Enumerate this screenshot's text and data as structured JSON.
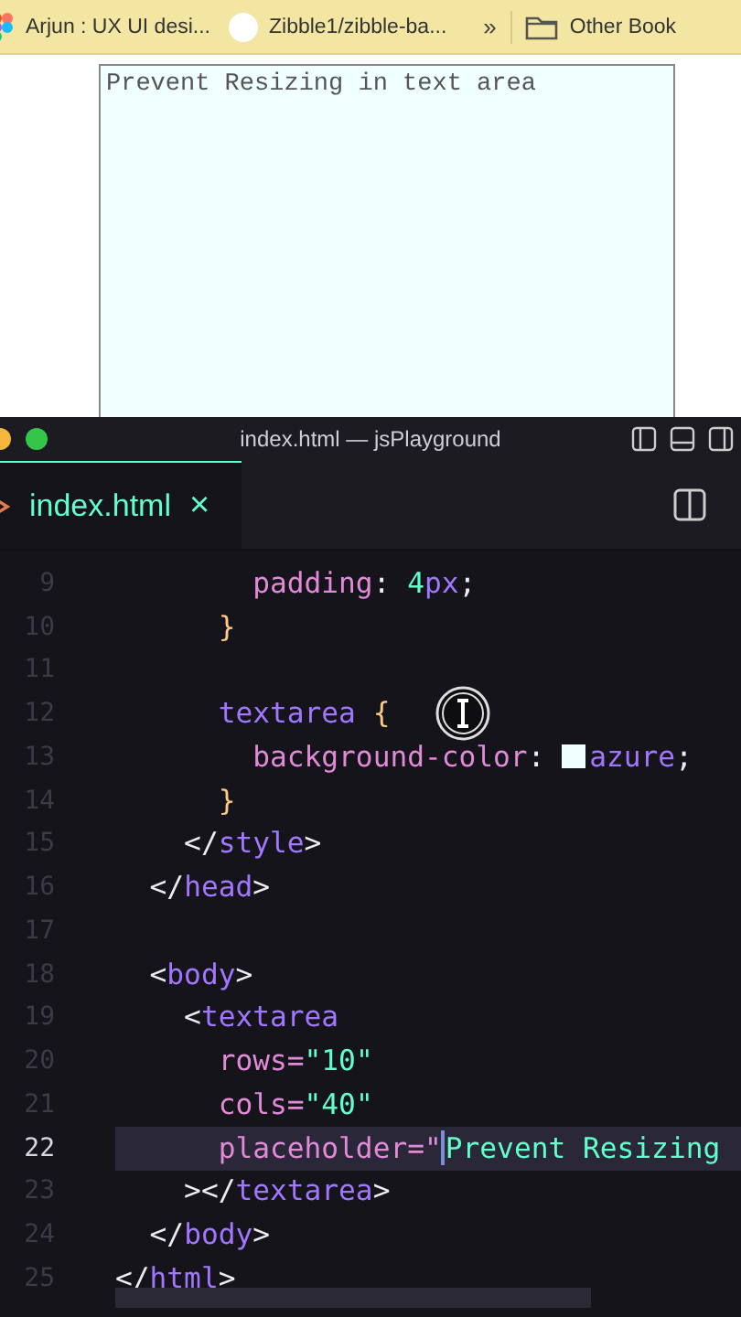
{
  "bookmarks_bar": {
    "items": [
      {
        "kind": "favicon",
        "label": "Arjun : UX UI desi..."
      },
      {
        "kind": "github",
        "label": "Zibble1/zibble-ba..."
      }
    ],
    "overflow": "»",
    "folder": {
      "label": "Other Book"
    }
  },
  "preview": {
    "textarea": {
      "placeholder": "Prevent Resizing in text area"
    }
  },
  "editor": {
    "window": {
      "title": "index.html — jsPlayground"
    },
    "tabs": [
      {
        "label": "index.html",
        "selected": true,
        "close": "×"
      }
    ],
    "lines": [
      {
        "number": "9",
        "selected": false,
        "tokens": [
          {
            "kind": "property",
            "text": "        padding"
          },
          {
            "kind": "punct",
            "text": ": "
          },
          {
            "kind": "number",
            "text": "4"
          },
          {
            "kind": "unit",
            "text": "px"
          },
          {
            "kind": "punct",
            "text": ";"
          }
        ]
      },
      {
        "number": "10",
        "selected": false,
        "tokens": [
          {
            "kind": "brace",
            "text": "      }"
          }
        ]
      },
      {
        "number": "11",
        "selected": false
      },
      {
        "number": "12",
        "selected": false,
        "tokens": [
          {
            "kind": "selector",
            "text": "      textarea"
          },
          {
            "kind": "brace",
            "text": " {"
          }
        ]
      },
      {
        "number": "13",
        "selected": false,
        "tokens": [
          {
            "kind": "property",
            "text": "        background-color"
          },
          {
            "kind": "punct",
            "text": ": "
          },
          {
            "kind": "swatch"
          },
          {
            "kind": "value",
            "text": "azure"
          },
          {
            "kind": "punct",
            "text": ";"
          }
        ]
      },
      {
        "number": "14",
        "selected": false,
        "tokens": [
          {
            "kind": "brace",
            "text": "      }"
          }
        ]
      },
      {
        "number": "15",
        "selected": false,
        "tokens": [
          {
            "kind": "bracket",
            "text": "    </"
          },
          {
            "kind": "tag",
            "text": "style"
          },
          {
            "kind": "bracket",
            "text": ">"
          }
        ]
      },
      {
        "number": "16",
        "selected": false,
        "tokens": [
          {
            "kind": "bracket",
            "text": "  </"
          },
          {
            "kind": "tag",
            "text": "head"
          },
          {
            "kind": "bracket",
            "text": ">"
          }
        ]
      },
      {
        "number": "17",
        "selected": false
      },
      {
        "number": "18",
        "selected": false,
        "tokens": [
          {
            "kind": "bracket",
            "text": "  <"
          },
          {
            "kind": "tag",
            "text": "body"
          },
          {
            "kind": "bracket",
            "text": ">"
          }
        ]
      },
      {
        "number": "19",
        "selected": false,
        "tokens": [
          {
            "kind": "bracket",
            "text": "    <"
          },
          {
            "kind": "tag",
            "text": "textarea"
          }
        ]
      },
      {
        "number": "20",
        "selected": false,
        "tokens": [
          {
            "kind": "attr",
            "text": "      rows="
          },
          {
            "kind": "string",
            "text": "\"10\""
          }
        ]
      },
      {
        "number": "21",
        "selected": false,
        "tokens": [
          {
            "kind": "attr",
            "text": "      cols="
          },
          {
            "kind": "string",
            "text": "\"40\""
          }
        ]
      },
      {
        "number": "22",
        "selected": true,
        "tokens": [
          {
            "kind": "attr",
            "text": "      placeholder=\""
          },
          {
            "kind": "caret"
          },
          {
            "kind": "plain-string",
            "text": "Prevent Resizing"
          }
        ]
      },
      {
        "number": "23",
        "selected": false,
        "tokens": [
          {
            "kind": "bracket",
            "text": "    ></"
          },
          {
            "kind": "tag",
            "text": "textarea"
          },
          {
            "kind": "bracket",
            "text": ">"
          }
        ]
      },
      {
        "number": "24",
        "selected": false,
        "tokens": [
          {
            "kind": "bracket",
            "text": "  </"
          },
          {
            "kind": "tag",
            "text": "body"
          },
          {
            "kind": "bracket",
            "text": ">"
          }
        ]
      },
      {
        "number": "25",
        "selected": false,
        "tokens": [
          {
            "kind": "bracket",
            "text": "</"
          },
          {
            "kind": "tag",
            "text": "html"
          },
          {
            "kind": "bracket",
            "text": ">"
          }
        ]
      }
    ]
  }
}
